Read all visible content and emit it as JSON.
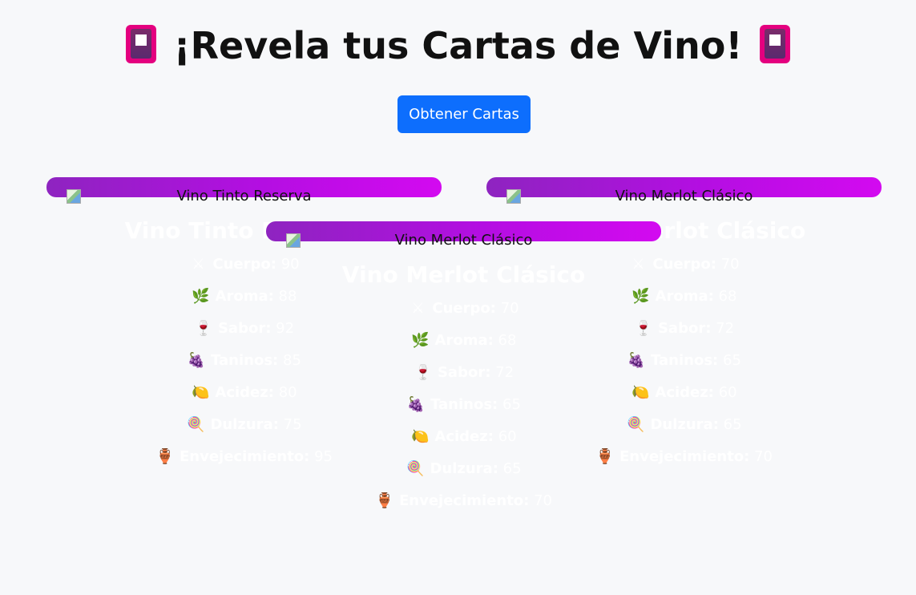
{
  "title": "¡Revela tus Cartas de Vino!",
  "title_icon": "flower-playing-card-icon",
  "button": {
    "label": "Obtener Cartas"
  },
  "stat_icons": {
    "cuerpo": "crossed-swords-icon",
    "aroma": "herb-icon",
    "sabor": "wine-glass-icon",
    "taninos": "grapes-icon",
    "acidez": "lemon-icon",
    "dulzura": "lollipop-icon",
    "envejecimiento": "amphora-icon"
  },
  "colors": {
    "button": "#0d6efd",
    "card_gradient_start": "#8e24c0",
    "card_gradient_end": "#d30af0",
    "background": "#f7f8fa"
  },
  "cards": [
    {
      "image_alt": "Vino Tinto Reserva",
      "name": "Vino Tinto Reserva",
      "stats": [
        {
          "label": "Cuerpo:",
          "value": "90"
        },
        {
          "label": "Aroma:",
          "value": "88"
        },
        {
          "label": "Sabor:",
          "value": "92"
        },
        {
          "label": "Taninos:",
          "value": "85"
        },
        {
          "label": "Acidez:",
          "value": "80"
        },
        {
          "label": "Dulzura:",
          "value": "75"
        },
        {
          "label": "Envejecimiento:",
          "value": "95"
        }
      ]
    },
    {
      "image_alt": "Vino Merlot Clásico",
      "name": "Vino Merlot Clásico",
      "stats": [
        {
          "label": "Cuerpo:",
          "value": "70"
        },
        {
          "label": "Aroma:",
          "value": "68"
        },
        {
          "label": "Sabor:",
          "value": "72"
        },
        {
          "label": "Taninos:",
          "value": "65"
        },
        {
          "label": "Acidez:",
          "value": "60"
        },
        {
          "label": "Dulzura:",
          "value": "65"
        },
        {
          "label": "Envejecimiento:",
          "value": "70"
        }
      ]
    },
    {
      "image_alt": "Vino Merlot Clásico",
      "name": "Vino Merlot Clásico",
      "stats": [
        {
          "label": "Cuerpo:",
          "value": "70"
        },
        {
          "label": "Aroma:",
          "value": "68"
        },
        {
          "label": "Sabor:",
          "value": "72"
        },
        {
          "label": "Taninos:",
          "value": "65"
        },
        {
          "label": "Acidez:",
          "value": "60"
        },
        {
          "label": "Dulzura:",
          "value": "65"
        },
        {
          "label": "Envejecimiento:",
          "value": "70"
        }
      ]
    }
  ]
}
